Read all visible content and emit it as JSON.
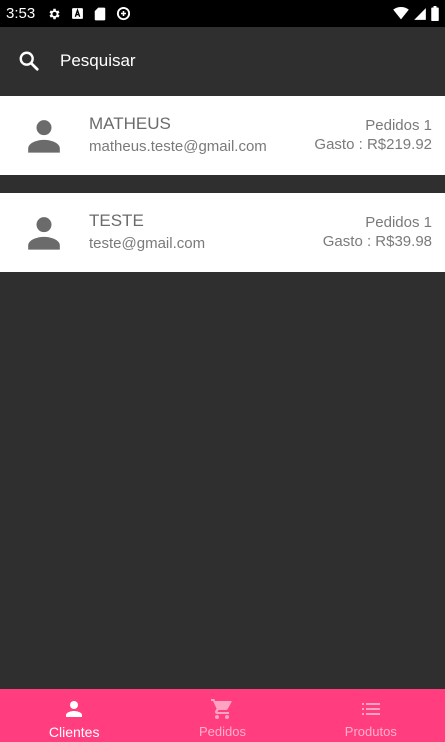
{
  "status_bar": {
    "time": "3:53",
    "left_icons": [
      "settings-icon",
      "app-a-icon",
      "sd-card-icon",
      "data-saver-icon"
    ],
    "right_icons": [
      "wifi-icon",
      "signal-icon",
      "battery-icon"
    ]
  },
  "search": {
    "placeholder": "Pesquisar",
    "value": ""
  },
  "clients": [
    {
      "name": "MATHEUS",
      "email": "matheus.teste@gmail.com",
      "orders": "Pedidos 1",
      "spent": "Gasto : R$219.92"
    },
    {
      "name": "TESTE",
      "email": "teste@gmail.com",
      "orders": "Pedidos 1",
      "spent": "Gasto : R$39.98"
    }
  ],
  "bottom_nav": {
    "tabs": [
      {
        "label": "Clientes",
        "icon": "person-icon",
        "active": true
      },
      {
        "label": "Pedidos",
        "icon": "cart-icon",
        "active": false
      },
      {
        "label": "Produtos",
        "icon": "list-icon",
        "active": false
      }
    ]
  },
  "colors": {
    "background": "#2f2f2f",
    "card": "#ffffff",
    "accent": "#ff3d7f",
    "status_bar": "#000000"
  }
}
